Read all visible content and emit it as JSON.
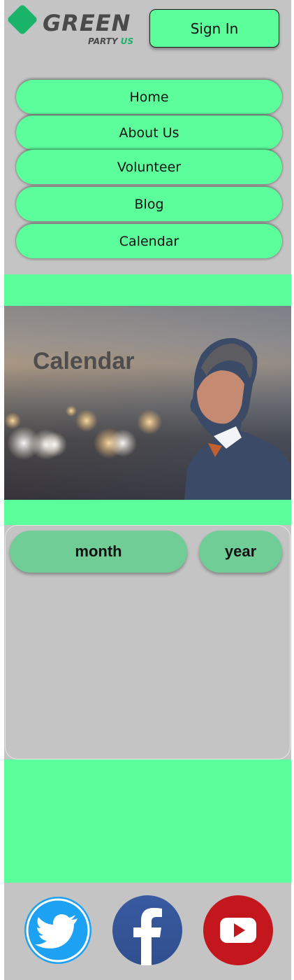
{
  "header": {
    "logo": {
      "word": "GREEN",
      "sub": "PARTY",
      "sub_accent": "US"
    },
    "signin_label": "Sign In"
  },
  "nav": {
    "items": [
      {
        "label": "Home"
      },
      {
        "label": "About Us"
      },
      {
        "label": "Volunteer"
      },
      {
        "label": "Blog"
      },
      {
        "label": "Calendar"
      }
    ]
  },
  "hero": {
    "title": "Calendar",
    "image": "photo-of-man-in-suit-with-bokeh-lights"
  },
  "calendar": {
    "tabs": [
      {
        "label": "month"
      },
      {
        "label": "year"
      }
    ]
  },
  "footer": {
    "social": [
      {
        "name": "twitter-icon",
        "color": "#1da1f2"
      },
      {
        "name": "facebook-icon",
        "color": "#3b5998"
      },
      {
        "name": "youtube-icon",
        "color": "#c4171d"
      }
    ]
  },
  "colors": {
    "accent": "#5cfd9b",
    "panel": "#c4c4c4",
    "pill": "#70cd96",
    "brand": "#19b36a"
  }
}
